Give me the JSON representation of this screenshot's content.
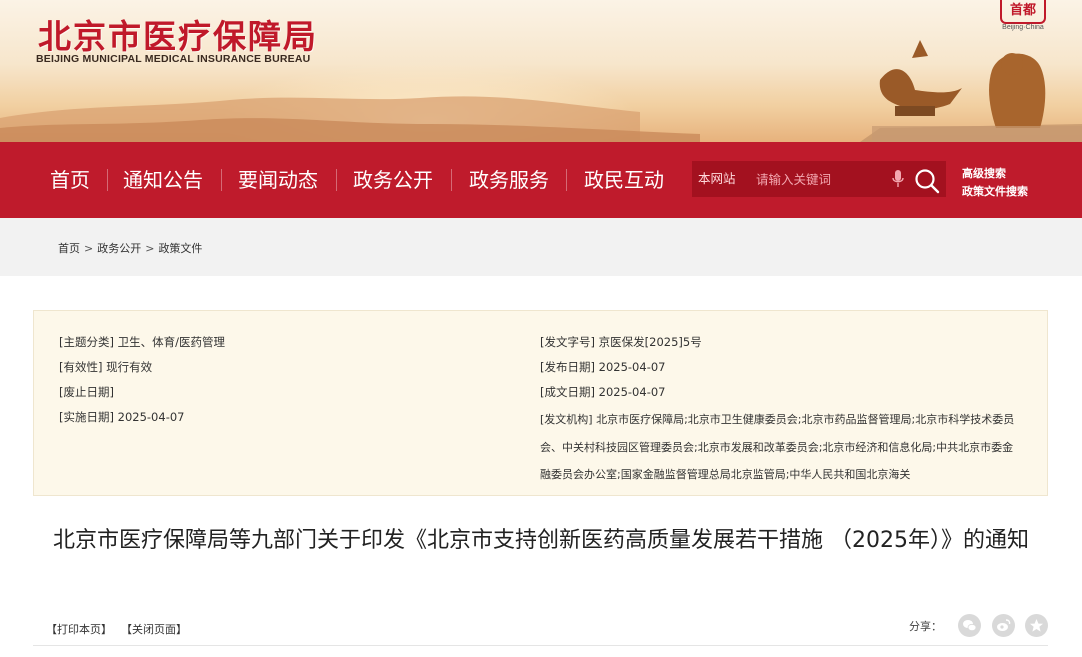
{
  "header": {
    "title_cn": "北京市医疗保障局",
    "title_en": "BEIJING MUNICIPAL MEDICAL INSURANCE BUREAU",
    "seal_text": "首都",
    "seal_sub": "Beijing·China"
  },
  "nav": {
    "items": [
      "首页",
      "通知公告",
      "要闻动态",
      "政务公开",
      "政务服务",
      "政民互动"
    ],
    "search_scope": "本网站",
    "search_placeholder": "请输入关键词",
    "advanced_search": "高级搜索",
    "policy_search": "政策文件搜索"
  },
  "breadcrumb": [
    "首页",
    "政务公开",
    "政策文件"
  ],
  "info": {
    "subject_label": "[主题分类]",
    "subject_value": "卫生、体育/医药管理",
    "validity_label": "[有效性]",
    "validity_value": "现行有效",
    "repeal_label": "[废止日期]",
    "repeal_value": "",
    "effective_label": "[实施日期]",
    "effective_value": "2025-04-07",
    "docno_label": "[发文字号]",
    "docno_value": "京医保发[2025]5号",
    "publish_label": "[发布日期]",
    "publish_value": "2025-04-07",
    "written_label": "[成文日期]",
    "written_value": "2025-04-07",
    "org_label": "[发文机构]",
    "org_value": "北京市医疗保障局;北京市卫生健康委员会;北京市药品监督管理局;北京市科学技术委员会、中关村科技园区管理委员会;北京市发展和改革委员会;北京市经济和信息化局;中共北京市委金融委员会办公室;国家金融监督管理总局北京监管局;中华人民共和国北京海关"
  },
  "document": {
    "title": "北京市医疗保障局等九部门关于印发《北京市支持创新医药高质量发展若干措施 （2025年）》的通知"
  },
  "toolbar": {
    "print": "【打印本页】",
    "close": "【关闭页面】",
    "share_label": "分享：",
    "share_icons": [
      "wechat-icon",
      "weibo-icon",
      "qzone-icon"
    ]
  },
  "colors": {
    "brand_red": "#bf1b2c",
    "info_bg": "#fdf8ea"
  }
}
